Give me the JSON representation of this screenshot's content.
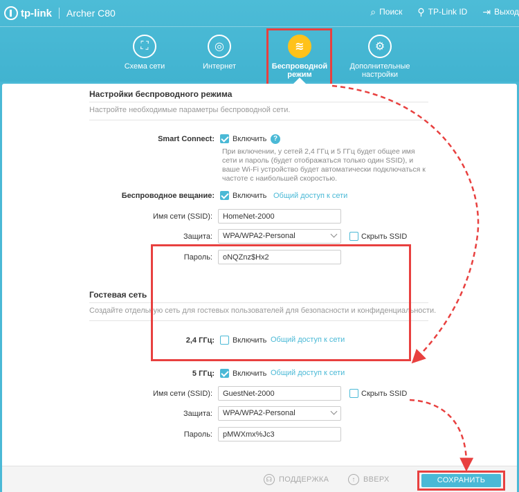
{
  "header": {
    "brand": "tp-link",
    "model": "Archer C80",
    "links": [
      {
        "label": "Поиск",
        "icon": "search-icon"
      },
      {
        "label": "TP-Link ID",
        "icon": "user-id-icon"
      },
      {
        "label": "Выход",
        "icon": "logout-icon"
      }
    ]
  },
  "tabs": [
    {
      "label": "Схема сети",
      "icon": "network-map-icon"
    },
    {
      "label": "Интернет",
      "icon": "globe-icon"
    },
    {
      "label": "Беспроводной режим",
      "icon": "wifi-icon",
      "active": true
    },
    {
      "label": "Дополнительные настройки",
      "icon": "gear-icon"
    }
  ],
  "wireless": {
    "title": "Настройки беспроводного режима",
    "desc": "Настройте необходимые параметры беспроводной сети.",
    "smart_connect_label": "Smart Connect:",
    "smart_connect_checked": true,
    "enable_label": "Включить",
    "smart_connect_note": "При включении, у сетей 2,4 ГГц и 5 ГГц будет общее имя сети и пароль (будет отображаться только один SSID), и ваше Wi-Fi устройство будет автоматически подключаться к частоте с наибольшей скоростью.",
    "broadcast_label": "Беспроводное вещание:",
    "broadcast_checked": true,
    "share_link": "Общий доступ к сети",
    "ssid_label": "Имя сети (SSID):",
    "ssid_value": "HomeNet-2000",
    "security_label": "Защита:",
    "security_value": "WPA/WPA2-Personal",
    "hide_ssid_label": "Скрыть SSID",
    "password_label": "Пароль:",
    "password_value": "oNQZnz$Hx2"
  },
  "guest": {
    "title": "Гостевая сеть",
    "desc": "Создайте отдельную сеть для гостевых пользователей для безопасности и конфиденциальности.",
    "band24_label": "2,4 ГГц:",
    "band24_checked": false,
    "band5_label": "5 ГГц:",
    "band5_checked": true,
    "enable_label": "Включить",
    "share_link": "Общий доступ к сети",
    "ssid_label": "Имя сети (SSID):",
    "ssid_value": "GuestNet-2000",
    "hide_ssid_label": "Скрыть SSID",
    "security_label": "Защита:",
    "security_value": "WPA/WPA2-Personal",
    "password_label": "Пароль:",
    "password_value": "pMWXmx%Jc3"
  },
  "footer": {
    "support": "ПОДДЕРЖКА",
    "up": "ВВЕРХ",
    "save": "СОХРАНИТЬ"
  },
  "colors": {
    "accent": "#4ab9d6",
    "highlight": "#e8403f",
    "active_tab": "#ffc21a"
  }
}
